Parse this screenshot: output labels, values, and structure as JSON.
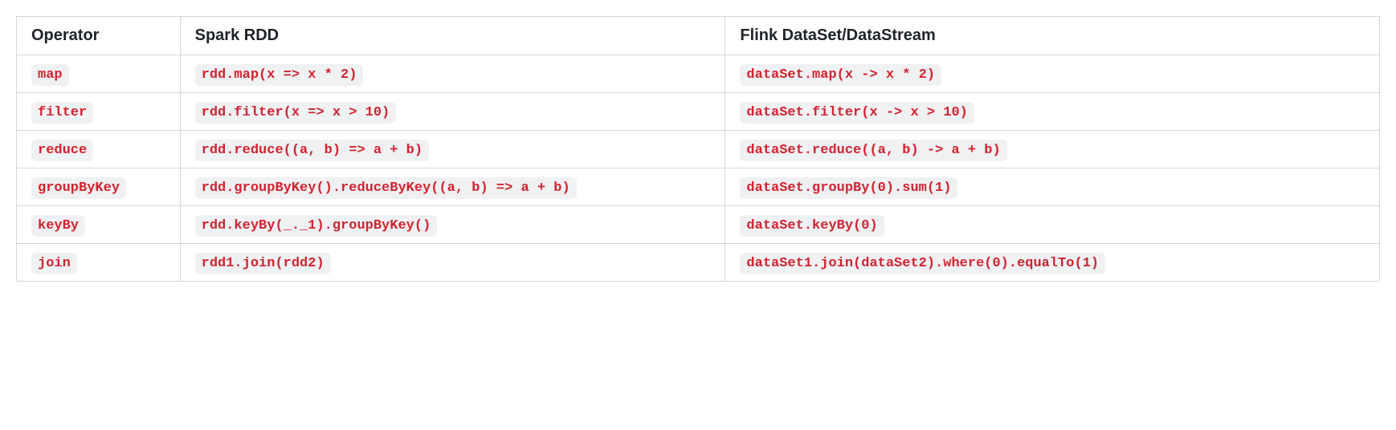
{
  "table": {
    "headers": {
      "operator": "Operator",
      "spark": "Spark RDD",
      "flink": "Flink DataSet/DataStream"
    },
    "rows": [
      {
        "operator": "map",
        "spark": "rdd.map(x => x * 2)",
        "flink": "dataSet.map(x -> x * 2)"
      },
      {
        "operator": "filter",
        "spark": "rdd.filter(x => x > 10)",
        "flink": "dataSet.filter(x -> x > 10)"
      },
      {
        "operator": "reduce",
        "spark": "rdd.reduce((a, b) => a + b)",
        "flink": "dataSet.reduce((a, b) -> a + b)"
      },
      {
        "operator": "groupByKey",
        "spark": "rdd.groupByKey().reduceByKey((a, b) => a + b)",
        "flink": "dataSet.groupBy(0).sum(1)"
      },
      {
        "operator": "keyBy",
        "spark": "rdd.keyBy(_._1).groupByKey()",
        "flink": "dataSet.keyBy(0)"
      },
      {
        "operator": "join",
        "spark": "rdd1.join(rdd2)",
        "flink": "dataSet1.join(dataSet2).where(0).equalTo(1)"
      }
    ]
  }
}
